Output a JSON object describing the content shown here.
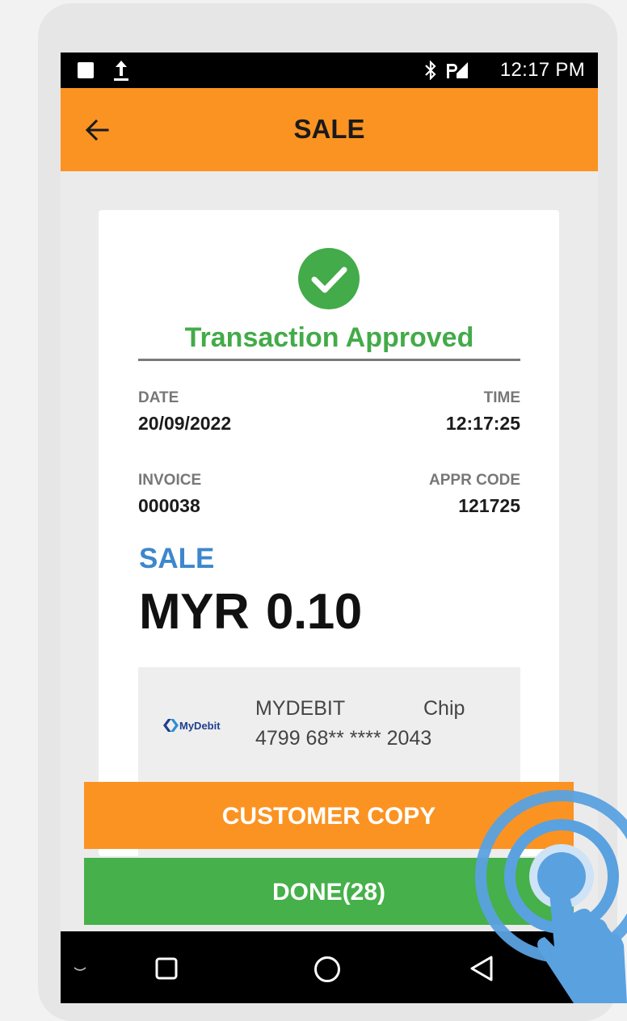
{
  "status_bar": {
    "time": "12:17 PM",
    "icons": [
      "notification-square-icon",
      "upload-icon",
      "bluetooth-icon",
      "signal-icon"
    ]
  },
  "app_bar": {
    "title": "SALE",
    "back_icon": "arrow-left-icon"
  },
  "receipt": {
    "status_icon": "check-circle-icon",
    "status": "Transaction Approved",
    "date_label": "DATE",
    "date_value": "20/09/2022",
    "time_label": "TIME",
    "time_value": "12:17:25",
    "invoice_label": "INVOICE",
    "invoice_value": "000038",
    "appr_code_label": "APPR CODE",
    "appr_code_value": "121725",
    "transaction_type": "SALE",
    "currency": "MYR",
    "amount": "0.10",
    "card": {
      "logo_text": "MyDebit",
      "scheme": "MYDEBIT",
      "entry_mode": "Chip",
      "masked_pan": "4799 68** **** 2043"
    }
  },
  "buttons": {
    "customer_copy": "CUSTOMER COPY",
    "done": "DONE(28)"
  },
  "nav_bar": {
    "icons": [
      "keyboard-hide-icon",
      "recent-apps-icon",
      "home-icon",
      "back-triangle-icon"
    ]
  },
  "colors": {
    "accent_orange": "#fb9322",
    "success_green": "#43ab49",
    "done_green": "#46b04a",
    "sale_blue": "#3d87cc",
    "tap_blue": "#5aa1e0"
  }
}
